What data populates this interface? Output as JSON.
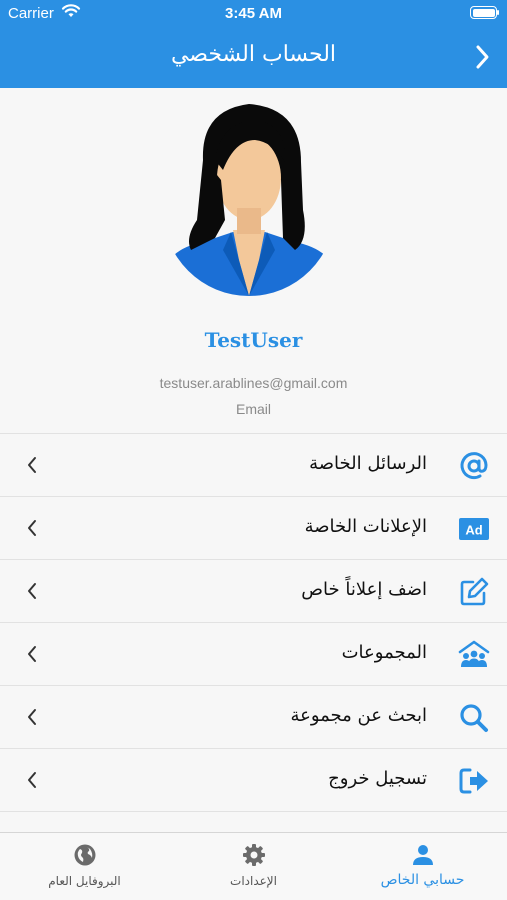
{
  "status_bar": {
    "carrier": "Carrier",
    "time": "3:45 AM"
  },
  "nav": {
    "title": "الحساب الشخصي"
  },
  "profile": {
    "username": "TestUser",
    "email": "testuser.arablines@gmail.com",
    "email_caption": "Email"
  },
  "menu": {
    "items": [
      {
        "label": "الرسائل الخاصة",
        "icon": "at-icon"
      },
      {
        "label": "الإعلانات الخاصة",
        "icon": "ad-icon"
      },
      {
        "label": "اضف إعلاناً خاص",
        "icon": "edit-icon"
      },
      {
        "label": "المجموعات",
        "icon": "groups-icon"
      },
      {
        "label": "ابحث عن مجموعة",
        "icon": "search-icon"
      },
      {
        "label": "تسجيل خروج",
        "icon": "logout-icon"
      }
    ]
  },
  "tabs": [
    {
      "label": "البروفايل العام",
      "icon": "globe-icon"
    },
    {
      "label": "الإعدادات",
      "icon": "gear-icon"
    },
    {
      "label": "حسابي الخاص",
      "icon": "person-icon",
      "active": true
    }
  ],
  "colors": {
    "accent": "#2b90e3",
    "background": "#f7f7f7",
    "muted": "#8a8a8a"
  }
}
